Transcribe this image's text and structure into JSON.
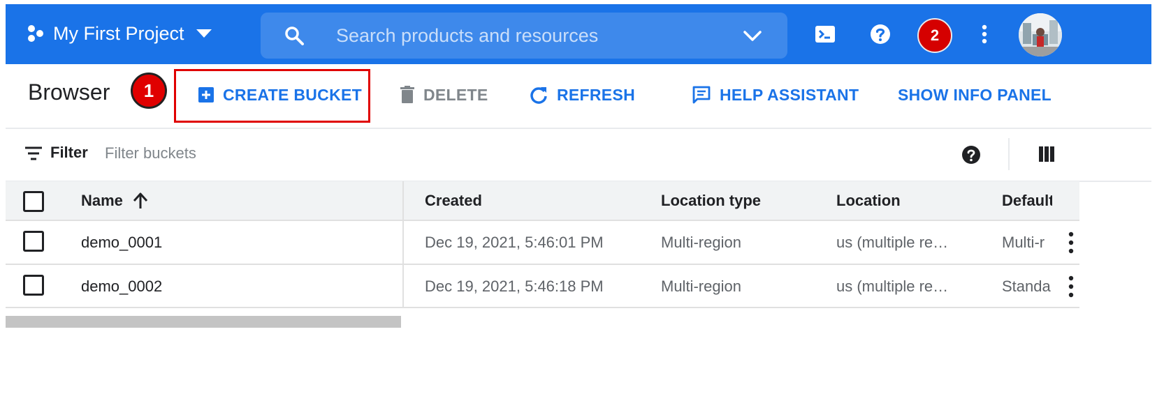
{
  "header": {
    "project_name": "My First Project",
    "search_placeholder": "Search products and resources",
    "notification_count": "2",
    "icons": [
      "project-hex-icon",
      "caret-down-icon",
      "search-icon",
      "chevron-down-icon",
      "cloud-shell-icon",
      "help-icon",
      "more-vert-icon",
      "avatar"
    ]
  },
  "toolbar": {
    "title": "Browser",
    "step_badge": "1",
    "create_bucket": "CREATE BUCKET",
    "delete": "DELETE",
    "refresh": "REFRESH",
    "help_assistant": "HELP ASSISTANT",
    "show_info_panel": "SHOW INFO PANEL"
  },
  "filter": {
    "label": "Filter",
    "placeholder": "Filter buckets"
  },
  "table": {
    "columns": {
      "name": "Name",
      "created": "Created",
      "location_type": "Location type",
      "location": "Location",
      "default": "Default"
    },
    "rows": [
      {
        "name": "demo_0001",
        "created": "Dec 19, 2021, 5:46:01 PM",
        "location_type": "Multi-region",
        "location": "us (multiple re…",
        "default": "Multi-r"
      },
      {
        "name": "demo_0002",
        "created": "Dec 19, 2021, 5:46:18 PM",
        "location_type": "Multi-region",
        "location": "us (multiple re…",
        "default": "Standa"
      }
    ]
  },
  "colors": {
    "brand_blue": "#1a73e8",
    "highlight_red": "#e00000",
    "notification_red": "#d50000"
  }
}
